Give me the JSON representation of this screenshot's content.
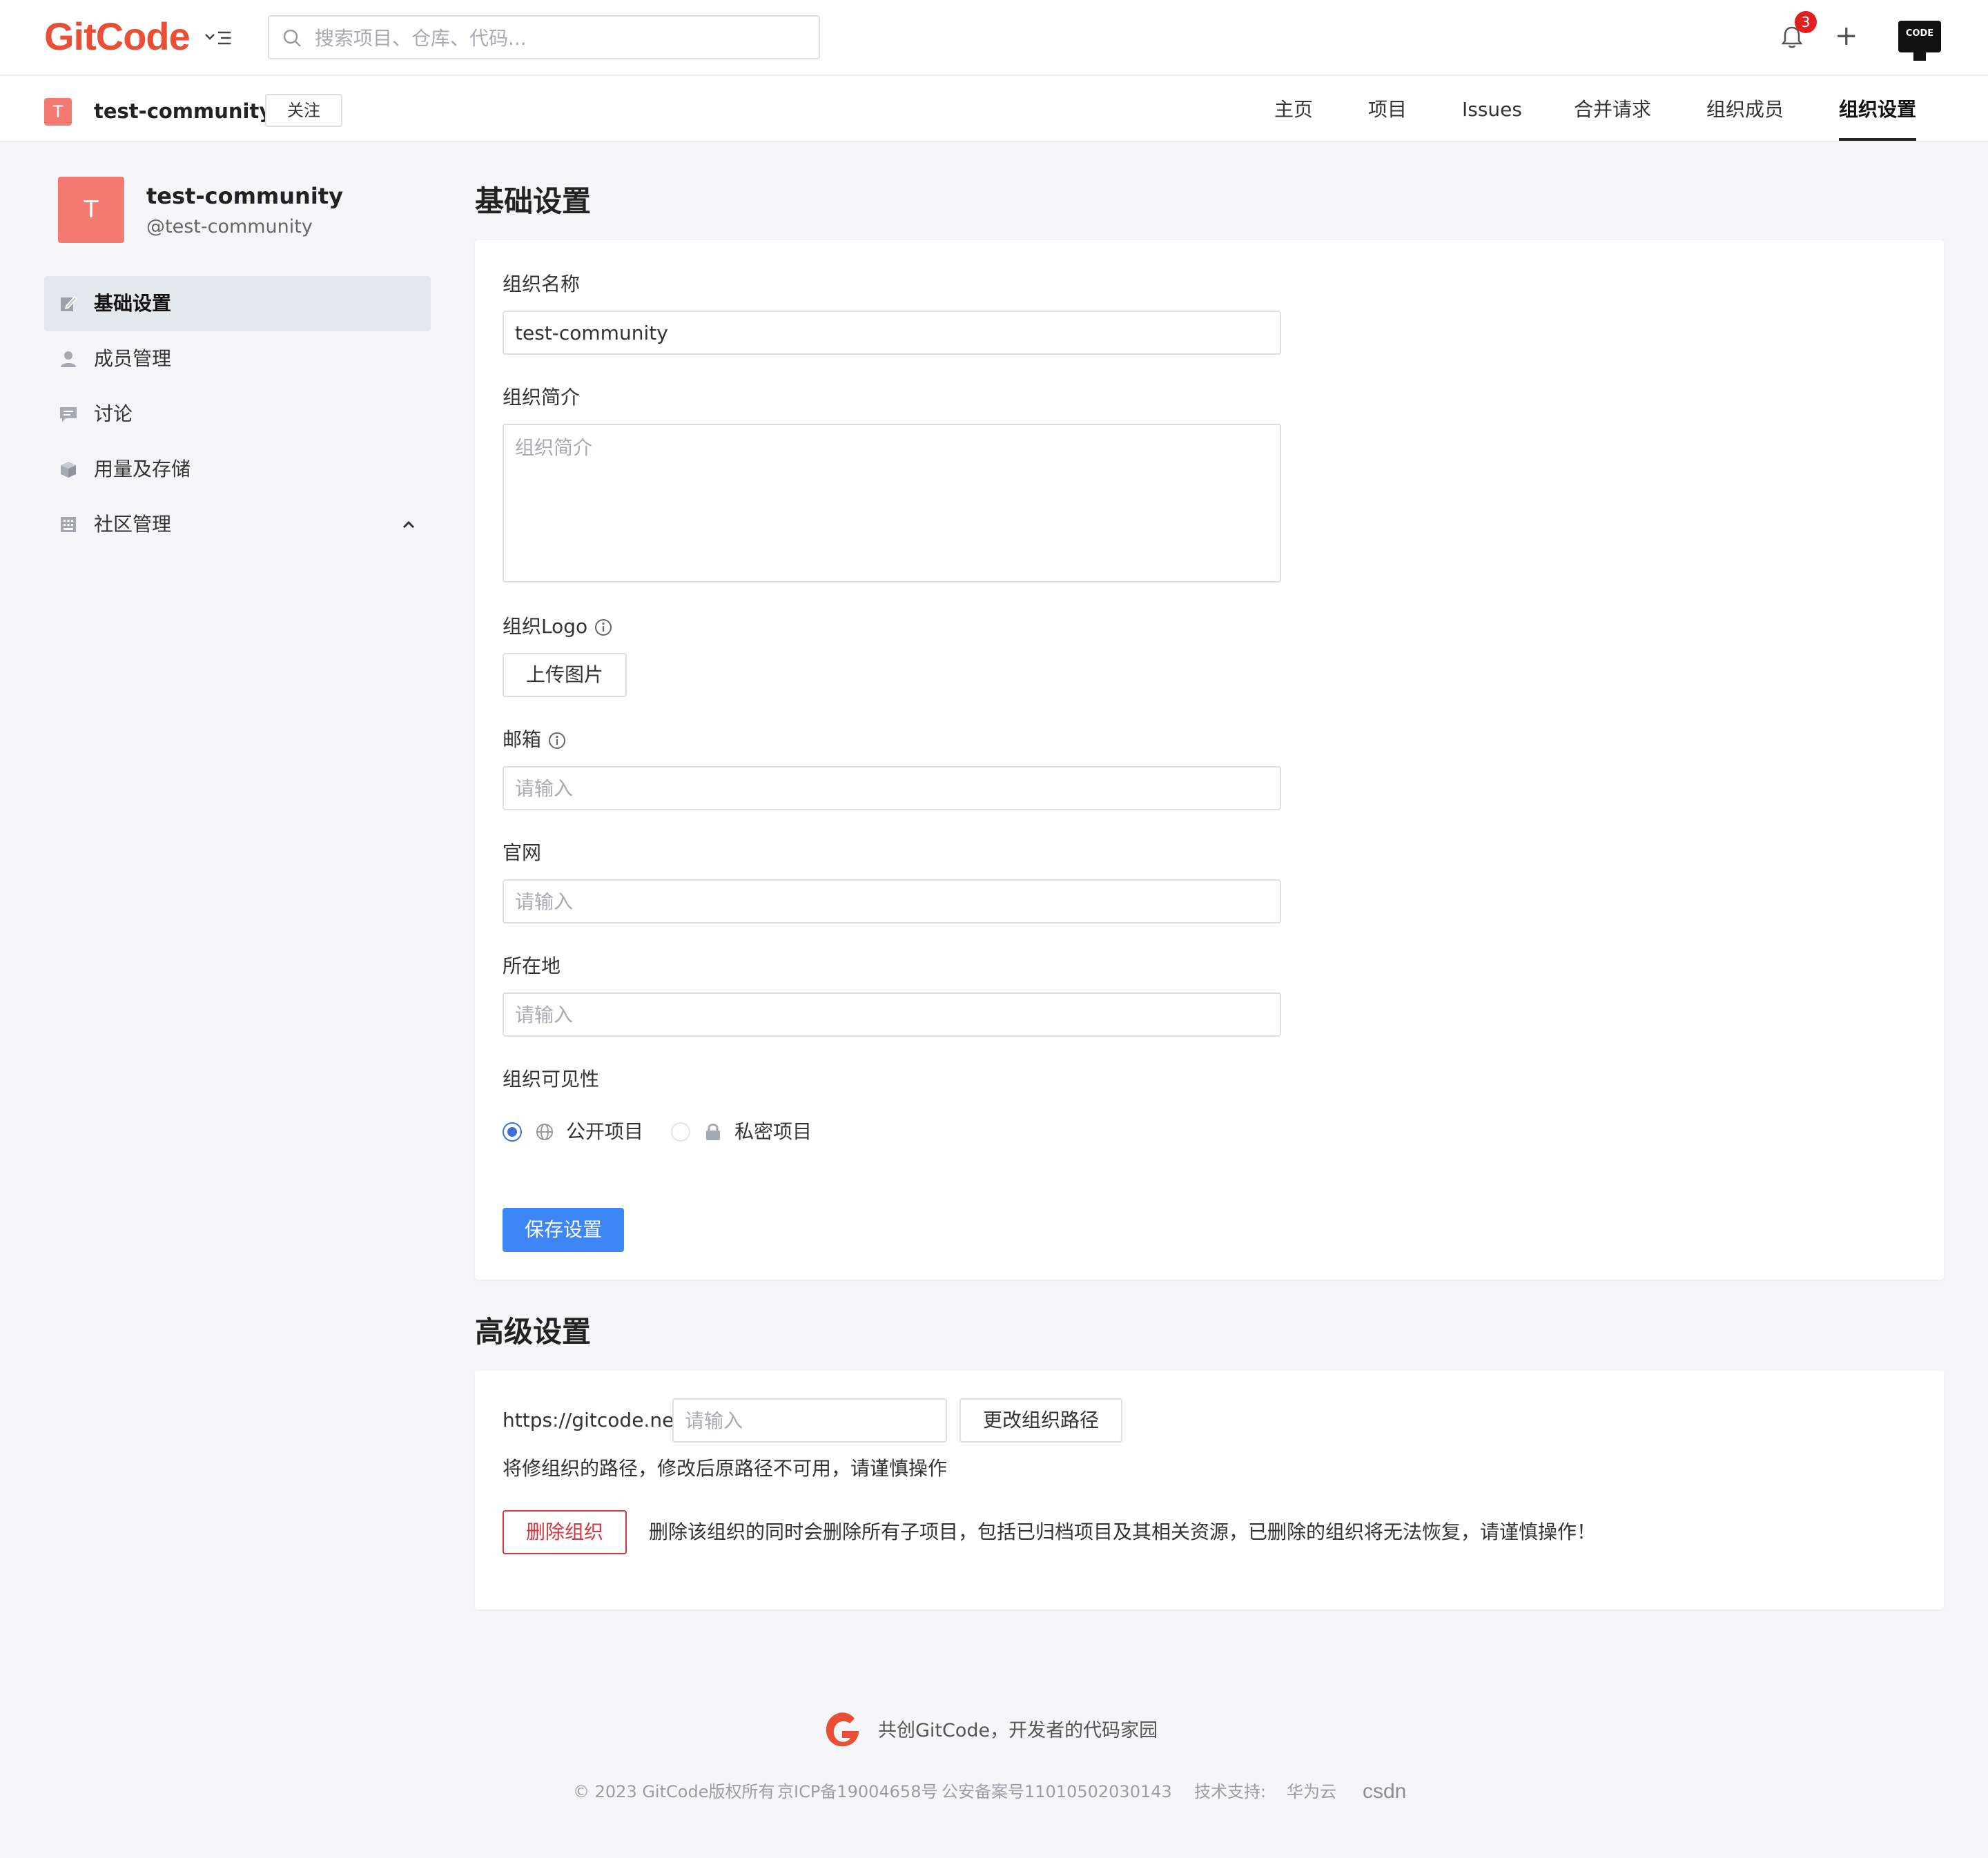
{
  "header": {
    "logo_text": "GitCode",
    "search_placeholder": "搜索项目、仓库、代码...",
    "notification_count": "3",
    "avatar_text": "CODE"
  },
  "org_bar": {
    "avatar_letter": "T",
    "name": "test-community",
    "follow_label": "关注",
    "tabs": [
      {
        "label": "主页",
        "active": false
      },
      {
        "label": "项目",
        "active": false
      },
      {
        "label": "Issues",
        "active": false
      },
      {
        "label": "合并请求",
        "active": false
      },
      {
        "label": "组织成员",
        "active": false
      },
      {
        "label": "组织设置",
        "active": true
      }
    ]
  },
  "sidebar": {
    "avatar_letter": "T",
    "title": "test-community",
    "handle": "@test-community",
    "items": [
      {
        "label": "基础设置",
        "icon": "edit-icon",
        "active": true
      },
      {
        "label": "成员管理",
        "icon": "user-icon",
        "active": false
      },
      {
        "label": "讨论",
        "icon": "chat-icon",
        "active": false
      },
      {
        "label": "用量及存储",
        "icon": "box-icon",
        "active": false
      },
      {
        "label": "社区管理",
        "icon": "building-icon",
        "active": false,
        "expanded": true
      }
    ]
  },
  "basic": {
    "section_title": "基础设置",
    "name_label": "组织名称",
    "name_value": "test-community",
    "desc_label": "组织简介",
    "desc_placeholder": "组织简介",
    "logo_label": "组织Logo",
    "upload_label": "上传图片",
    "email_label": "邮箱",
    "email_placeholder": "请输入",
    "website_label": "官网",
    "website_placeholder": "请输入",
    "location_label": "所在地",
    "location_placeholder": "请输入",
    "visibility_label": "组织可见性",
    "visibility_options": [
      {
        "label": "公开项目",
        "selected": true
      },
      {
        "label": "私密项目",
        "selected": false
      }
    ],
    "save_label": "保存设置"
  },
  "advanced": {
    "section_title": "高级设置",
    "url_prefix": "https://gitcode.net/",
    "path_placeholder": "请输入",
    "change_path_label": "更改组织路径",
    "path_warning": "将修组织的路径，修改后原路径不可用，请谨慎操作",
    "delete_label": "删除组织",
    "delete_warning": "删除该组织的同时会删除所有子项目，包括已归档项目及其相关资源，已删除的组织将无法恢复，请谨慎操作！"
  },
  "footer": {
    "slogan": "共创GitCode，开发者的代码家园",
    "copyright": "© 2023 GitCode版权所有",
    "icp": "京ICP备19004658号",
    "police": "公安备案号11010502030143",
    "support_label": "技术支持:",
    "support_huawei": "华为云",
    "support_csdn": "csdn"
  },
  "colors": {
    "brand": "#e94f36",
    "primary": "#3e86f5",
    "danger": "#d4363b",
    "avatar": "#f47a72"
  }
}
